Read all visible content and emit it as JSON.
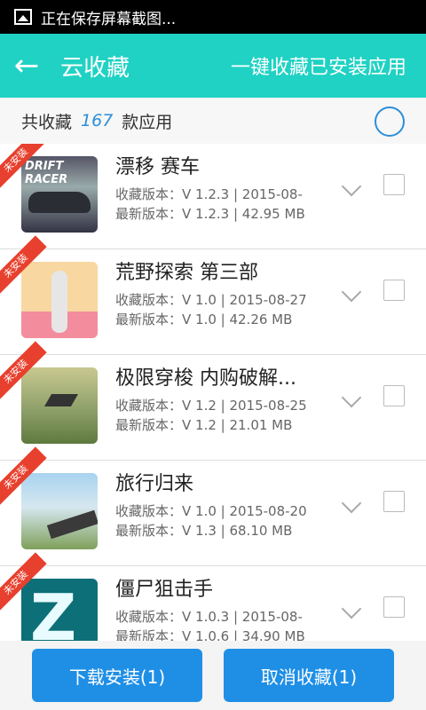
{
  "status_bar": {
    "message": "正在保存屏幕截图..."
  },
  "header": {
    "back_icon": "←",
    "title": "云收藏",
    "action": "一键收藏已安装应用"
  },
  "summary": {
    "prefix": "共收藏",
    "count": "167",
    "suffix": "款应用"
  },
  "apps": [
    {
      "badge": "未安装",
      "thumb_text": "DRIFT RACER",
      "name": "漂移 赛车",
      "collected_version": "收藏版本：V 1.2.3 | 2015-08-",
      "latest_version": "最新版本：V 1.2.3 | 42.95 MB"
    },
    {
      "badge": "未安装",
      "name": "荒野探索 第三部",
      "collected_version": "收藏版本：V 1.0 | 2015-08-27",
      "latest_version": "最新版本：V 1.0 | 42.26 MB"
    },
    {
      "badge": "未安装",
      "name": "极限穿梭 内购破解...",
      "collected_version": "收藏版本：V 1.2 | 2015-08-25",
      "latest_version": "最新版本：V 1.2 | 21.01 MB"
    },
    {
      "badge": "未安装",
      "name": "旅行归来",
      "collected_version": "收藏版本：V 1.0 | 2015-08-20",
      "latest_version": "最新版本：V 1.3 | 68.10 MB"
    },
    {
      "badge": "未安装",
      "thumb_text": "Z",
      "name": "僵尸狙击手",
      "collected_version": "收藏版本：V 1.0.3 | 2015-08-",
      "latest_version": "最新版本：V 1.0.6 | 34.90 MB"
    }
  ],
  "buttons": {
    "install": "下载安装(1)",
    "cancel": "取消收藏(1)"
  },
  "colors": {
    "header": "#1fd2c3",
    "accent": "#1f8fe6",
    "badge": "#e8402e"
  }
}
